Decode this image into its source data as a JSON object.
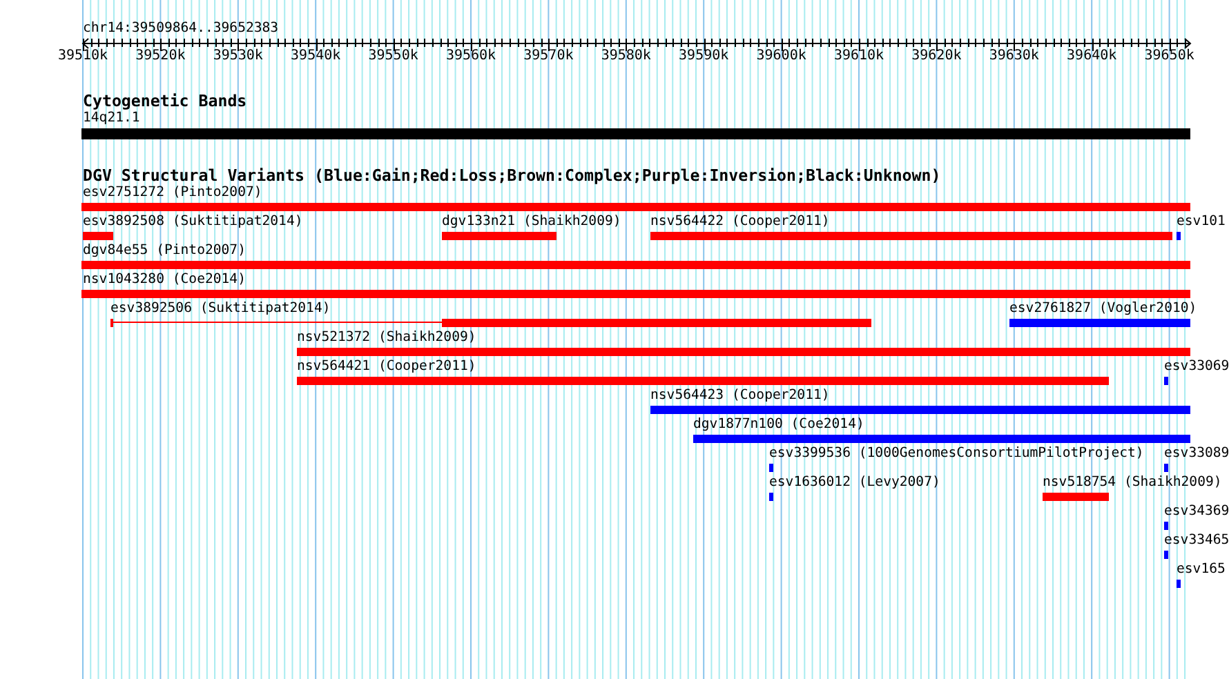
{
  "locus": "chr14:39509864..39652383",
  "ruler": {
    "ticks": [
      "39510k",
      "39520k",
      "39530k",
      "39540k",
      "39550k",
      "39560k",
      "39570k",
      "39580k",
      "39590k",
      "39600k",
      "39610k",
      "39620k",
      "39630k",
      "39640k",
      "39650k"
    ]
  },
  "tracks": [
    {
      "kind": "bands",
      "title": "Cytogenetic Bands",
      "features": [
        {
          "label": "14q21.1",
          "color": "#000000"
        }
      ]
    },
    {
      "kind": "variants",
      "title": "DGV Structural Variants (Blue:Gain;Red:Loss;Brown:Complex;Purple:Inversion;Black:Unknown)",
      "features": [
        {
          "label": "esv2751272 (Pinto2007)",
          "color": "#ff0000"
        },
        {
          "label": "esv3892508 (Suktitipat2014)",
          "color": "#ff0000"
        },
        {
          "label": "dgv133n21 (Shaikh2009)",
          "color": "#ff0000"
        },
        {
          "label": "nsv564422 (Cooper2011)",
          "color": "#ff0000"
        },
        {
          "label": "esv101",
          "color": "#0000ff"
        },
        {
          "label": "dgv84e55 (Pinto2007)",
          "color": "#ff0000"
        },
        {
          "label": "nsv1043280 (Coe2014)",
          "color": "#ff0000"
        },
        {
          "label": "esv3892506 (Suktitipat2014)",
          "color": "#ff0000"
        },
        {
          "label": "esv2761827 (Vogler2010)",
          "color": "#0000ff"
        },
        {
          "label": "nsv521372 (Shaikh2009)",
          "color": "#ff0000"
        },
        {
          "label": "nsv564421 (Cooper2011)",
          "color": "#ff0000"
        },
        {
          "label": "esv33069",
          "color": "#0000ff"
        },
        {
          "label": "nsv564423 (Cooper2011)",
          "color": "#0000ff"
        },
        {
          "label": "dgv1877n100 (Coe2014)",
          "color": "#0000ff"
        },
        {
          "label": "esv3399536 (1000GenomesConsortiumPilotProject)",
          "color": "#0000ff"
        },
        {
          "label": "esv33089",
          "color": "#0000ff"
        },
        {
          "label": "esv1636012 (Levy2007)",
          "color": "#0000ff"
        },
        {
          "label": "nsv518754 (Shaikh2009)",
          "color": "#ff0000"
        },
        {
          "label": "esv34369",
          "color": "#0000ff"
        },
        {
          "label": "esv33465",
          "color": "#0000ff"
        },
        {
          "label": "esv165",
          "color": "#0000ff"
        }
      ]
    }
  ]
}
